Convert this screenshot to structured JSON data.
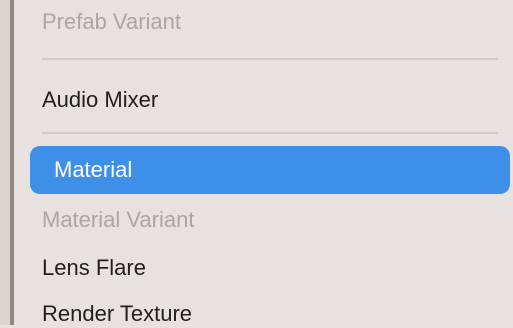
{
  "menu": {
    "items": [
      {
        "label": "Prefab Variant",
        "state": "disabled"
      },
      {
        "label": "Audio Mixer",
        "state": "enabled"
      },
      {
        "label": "Material",
        "state": "selected"
      },
      {
        "label": "Material Variant",
        "state": "disabled"
      },
      {
        "label": "Lens Flare",
        "state": "enabled"
      },
      {
        "label": "Render Texture",
        "state": "enabled"
      }
    ]
  },
  "colors": {
    "selection": "#3d8fe8",
    "background": "#e7e2df",
    "disabled_text": "#aaa6a4"
  }
}
